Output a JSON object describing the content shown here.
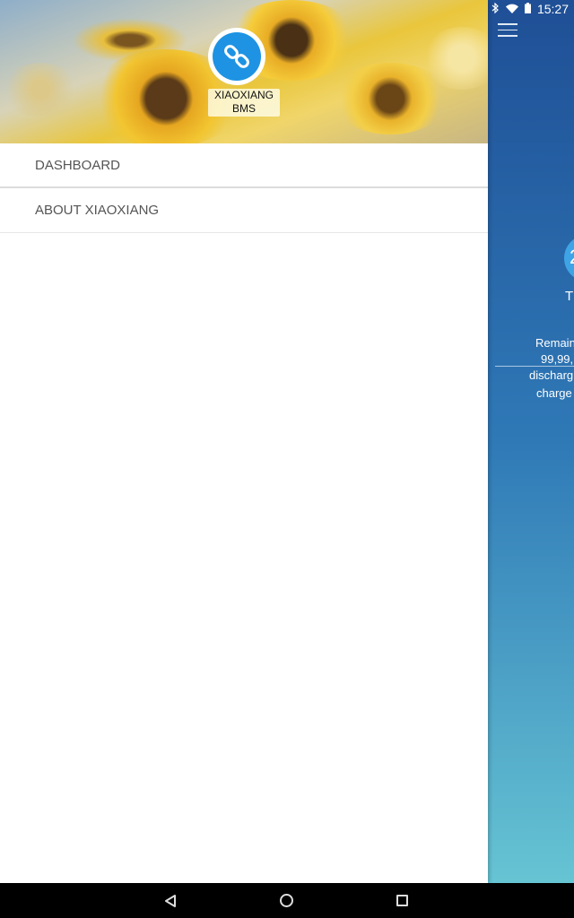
{
  "status_bar": {
    "time": "15:27",
    "icons": [
      "location-icon",
      "bluetooth-icon",
      "wifi-icon",
      "battery-icon"
    ]
  },
  "background_app": {
    "circle_text": "2",
    "label": "T",
    "lines": [
      "Remain",
      "99,99,",
      "discharg",
      "charge"
    ]
  },
  "drawer": {
    "app_name_line1": "XIAOXIANG",
    "app_name_line2": "BMS",
    "items": [
      {
        "label": "DASHBOARD"
      },
      {
        "label": "ABOUT XIAOXIANG"
      }
    ]
  },
  "colors": {
    "accent": "#1e93e3",
    "gradient_top": "#1f4f96",
    "gradient_bottom": "#66c4d3"
  }
}
